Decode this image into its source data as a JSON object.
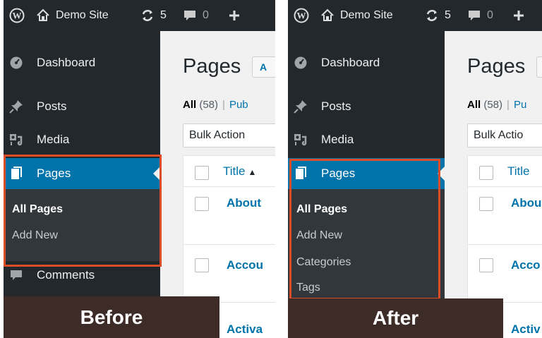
{
  "adminbar": {
    "site_name": "Demo Site",
    "updates_count": "5",
    "comments_count": "0"
  },
  "sidebar": {
    "dashboard": "Dashboard",
    "posts": "Posts",
    "media": "Media",
    "pages": "Pages",
    "comments": "Comments"
  },
  "submenu_before": [
    "All Pages",
    "Add New"
  ],
  "submenu_after": [
    "All Pages",
    "Add New",
    "Categories",
    "Tags"
  ],
  "content": {
    "title": "Pages",
    "add_new_clip": "A",
    "filter_all": "All",
    "filter_count": "(58)",
    "filter_published_before": "Pub",
    "filter_published_after": "Pu",
    "bulk_actions_before": "Bulk Action",
    "bulk_actions_after": "Bulk Actio",
    "column_title": "Title",
    "row1_before": "About",
    "row1_after": "Abou",
    "row2_before": "Accou",
    "row2_after": "Acco",
    "row3_before": "Activa",
    "row3_after": "Activ"
  },
  "captions": {
    "before": "Before",
    "after": "After"
  },
  "colors": {
    "adminbar_bg": "#23282d",
    "menu_current_bg": "#0073aa",
    "submenu_bg": "#32373c",
    "highlight": "#dc4c28",
    "caption_bg": "#3c2b27",
    "link": "#0073aa"
  },
  "icons": {
    "logo": "wordpress-logo-icon",
    "home": "home-icon",
    "updates": "updates-icon",
    "comments_bubble": "comment-bubble-icon",
    "new": "plus-icon",
    "dashboard": "dashboard-gauge-icon",
    "posts": "pushpin-icon",
    "media": "media-icon",
    "pages": "pages-icon"
  }
}
